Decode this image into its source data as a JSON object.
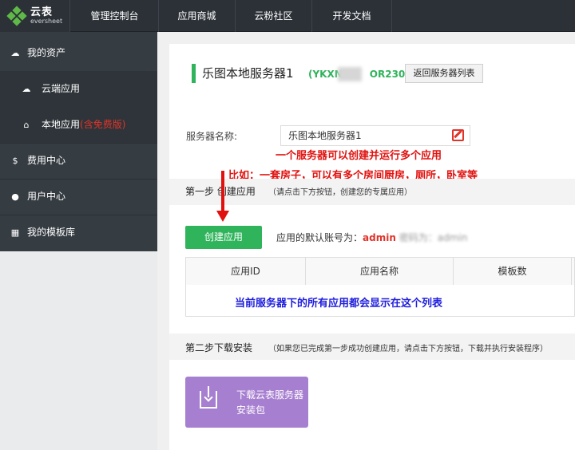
{
  "logo": {
    "cn": "云表",
    "en": "eversheet"
  },
  "topnav": [
    "管理控制台",
    "应用商城",
    "云粉社区",
    "开发文档"
  ],
  "sidebar": {
    "items": [
      {
        "icon": "cloud-icon",
        "label": "我的资产"
      },
      {
        "icon": "cloud-icon",
        "label": "云端应用"
      },
      {
        "icon": "home-icon",
        "label": "本地应用",
        "badge": "(含免费版)"
      },
      {
        "icon": "dollar-icon",
        "label": "费用中心"
      },
      {
        "icon": "user-icon",
        "label": "用户中心"
      },
      {
        "icon": "gift-icon",
        "label": "我的模板库"
      }
    ]
  },
  "server": {
    "title": "乐图本地服务器1",
    "code_prefix": "(YKXN",
    "code_suffix": "OR230)",
    "back_button": "返回服务器列表",
    "name_label": "服务器名称:",
    "name_value": "乐图本地服务器1"
  },
  "annotations": {
    "a1": "一个服务器可以创建并运行多个应用",
    "a2": "比如：一套房子，可以有多个房间厨房，厕所，卧室等",
    "a3": "当前服务器下的所有应用都会显示在这个列表"
  },
  "step1": {
    "title": "第一步 创建应用",
    "hint": "（请点击下方按钮，创建您的专属应用）",
    "create_button": "创建应用",
    "account_prefix": "应用的默认账号为：",
    "account_user": "admin",
    "account_pwd_label": "密码为：",
    "account_pwd": "admin"
  },
  "table": {
    "headers": [
      "应用ID",
      "应用名称",
      "模板数"
    ]
  },
  "step2": {
    "title": "第二步下载安装",
    "hint": "（如果您已完成第一步成功创建应用，请点击下方按钮，下载并执行安装程序）",
    "download_button": "下载云表服务器安装包"
  },
  "colors": {
    "accent": "#2fb35b",
    "sidebar": "#353c42",
    "topbar": "#2b3137",
    "download": "#a77fd0",
    "annotation_red": "#e0110e",
    "annotation_blue": "#1e1edc"
  }
}
